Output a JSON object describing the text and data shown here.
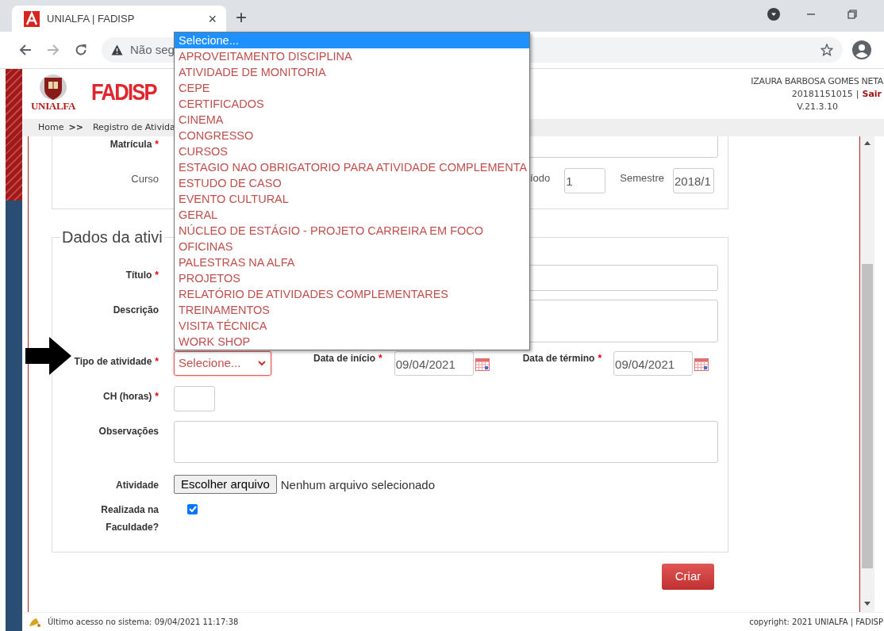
{
  "browser": {
    "tab_title": "UNIALFA | FADISP",
    "tab_close": "×",
    "new_tab": "+",
    "address": "Não seg"
  },
  "header": {
    "logo_text": "UNIALFA",
    "brand": "FADISP",
    "user_name": "IZAURA BARBOSA GOMES NETA",
    "user_id": "20181151015",
    "separator": "|",
    "logout": "Sair",
    "version": "V.21.3.10"
  },
  "breadcrumb": {
    "home": "Home",
    "separator": ">>",
    "current": "Registro de Ativida"
  },
  "student": {
    "matricula": {
      "label": "Matrícula",
      "mark": "*"
    },
    "curso": {
      "label": "Curso"
    },
    "periodo": {
      "label": "íodo",
      "value": "1"
    },
    "semestre": {
      "label": "Semestre",
      "value": "2018/1"
    }
  },
  "activity": {
    "legend": "Dados da ativi",
    "titulo": {
      "label": "Título",
      "mark": "*"
    },
    "descricao": {
      "label": "Descrição"
    },
    "tipo": {
      "label": "Tipo de atividade",
      "mark": "*",
      "value": "Selecione..."
    },
    "data_inicio": {
      "label": "Data de início",
      "mark": "*",
      "value": "09/04/2021"
    },
    "data_termino": {
      "label": "Data de término",
      "mark": "*",
      "value": "09/04/2021"
    },
    "ch": {
      "label": "CH (horas)",
      "mark": "*"
    },
    "observacoes": {
      "label": "Observações"
    },
    "atividade": {
      "label": "Atividade",
      "button": "Escolher arquivo",
      "status": "Nenhum arquivo selecionado"
    },
    "realizada": {
      "label": "Realizada na Faculdade?",
      "checked": true
    }
  },
  "submit": "Criar",
  "dropdown": {
    "options": [
      {
        "label": "Selecione...",
        "selected": true
      },
      {
        "label": "APROVEITAMENTO DISCIPLINA",
        "selected": false
      },
      {
        "label": "ATIVIDADE DE MONITORIA",
        "selected": false
      },
      {
        "label": "CEPE",
        "selected": false
      },
      {
        "label": "CERTIFICADOS",
        "selected": false
      },
      {
        "label": "CINEMA",
        "selected": false
      },
      {
        "label": "CONGRESSO",
        "selected": false
      },
      {
        "label": "CURSOS",
        "selected": false
      },
      {
        "label": "ESTAGIO NAO OBRIGATORIO PARA ATIVIDADE COMPLEMENTA",
        "selected": false
      },
      {
        "label": "ESTUDO DE CASO",
        "selected": false
      },
      {
        "label": "EVENTO CULTURAL",
        "selected": false
      },
      {
        "label": "GERAL",
        "selected": false
      },
      {
        "label": "NÚCLEO DE ESTÁGIO - PROJETO CARREIRA EM FOCO",
        "selected": false
      },
      {
        "label": "OFICINAS",
        "selected": false
      },
      {
        "label": "PALESTRAS NA ALFA",
        "selected": false
      },
      {
        "label": "PROJETOS",
        "selected": false
      },
      {
        "label": "RELATÓRIO DE ATIVIDADES COMPLEMENTARES",
        "selected": false
      },
      {
        "label": "TREINAMENTOS",
        "selected": false
      },
      {
        "label": "VISITA TÉCNICA",
        "selected": false
      },
      {
        "label": "WORK SHOP",
        "selected": false
      }
    ]
  },
  "footer": {
    "last_access": "Último acesso no sistema: 09/04/2021 11:17:38",
    "copyright": "copyright: 2021 UNIALFA | FADISP"
  }
}
